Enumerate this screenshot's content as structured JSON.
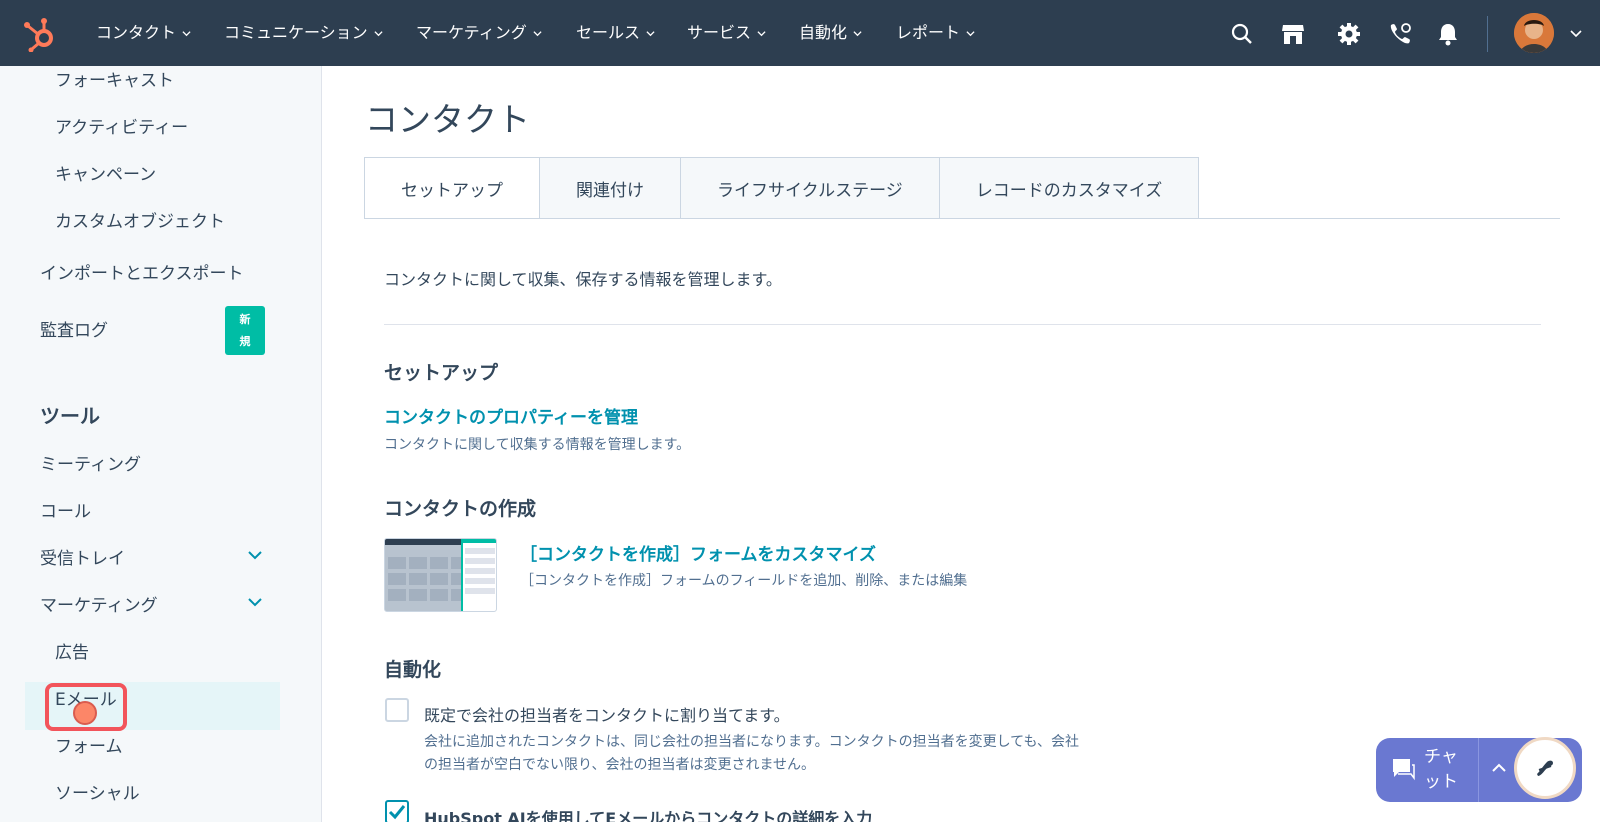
{
  "topnav": {
    "items": [
      {
        "label": "コンタクト"
      },
      {
        "label": "コミュニケーション"
      },
      {
        "label": "マーケティング"
      },
      {
        "label": "セールス"
      },
      {
        "label": "サービス"
      },
      {
        "label": "自動化"
      },
      {
        "label": "レポート"
      }
    ],
    "icons": [
      "search-icon",
      "marketplace-icon",
      "settings-icon",
      "calling-icon",
      "notifications-icon"
    ]
  },
  "sidebar": {
    "items_top": [
      {
        "label": "フォーキャスト"
      },
      {
        "label": "アクティビティー"
      },
      {
        "label": "キャンペーン"
      },
      {
        "label": "カスタムオブジェクト"
      }
    ],
    "import_export": "インポートとエクスポート",
    "audit_log": "監査ログ",
    "new_badge": [
      "新",
      "規"
    ],
    "tools_heading": "ツール",
    "tools": [
      {
        "label": "ミーティング"
      },
      {
        "label": "コール"
      },
      {
        "label": "受信トレイ"
      },
      {
        "label": "マーケティング"
      }
    ],
    "marketing_sub": [
      {
        "label": "広告"
      },
      {
        "label": "Eメール"
      },
      {
        "label": "フォーム"
      },
      {
        "label": "ソーシャル"
      }
    ],
    "active_item": "Eメール"
  },
  "main": {
    "title": "コンタクト",
    "tabs": [
      {
        "label": "セットアップ"
      },
      {
        "label": "関連付け"
      },
      {
        "label": "ライフサイクルステージ"
      },
      {
        "label": "レコードのカスタマイズ"
      }
    ],
    "description": "コンタクトに関して収集、保存する情報を管理します。",
    "setup": {
      "heading": "セットアップ",
      "link": "コンタクトのプロパティーを管理",
      "sub": "コンタクトに関して収集する情報を管理します。"
    },
    "create": {
      "heading": "コンタクトの作成",
      "link": "［コンタクトを作成］フォームをカスタマイズ",
      "sub": "［コンタクトを作成］フォームのフィールドを追加、削除、または編集"
    },
    "automation": {
      "heading": "自動化",
      "option1": {
        "label": "既定で会社の担当者をコンタクトに割り当てます。",
        "sub_line1": "会社に追加されたコンタクトは、同じ会社の担当者になります。コンタクトの担当者を変更しても、会社",
        "sub_line2": "の担当者が空白でない限り、会社の担当者は変更されません。",
        "checked": false
      },
      "option2": {
        "label": "HubSpot AIを使用してEメールからコンタクトの詳細を入力",
        "checked": true
      }
    }
  },
  "chat": {
    "label": "チャット"
  },
  "colors": {
    "topbar": "#2d3e50",
    "link": "#0091ae",
    "badge": "#00bda5",
    "chat": "#6a78d1",
    "highlight": "#f2545b"
  }
}
